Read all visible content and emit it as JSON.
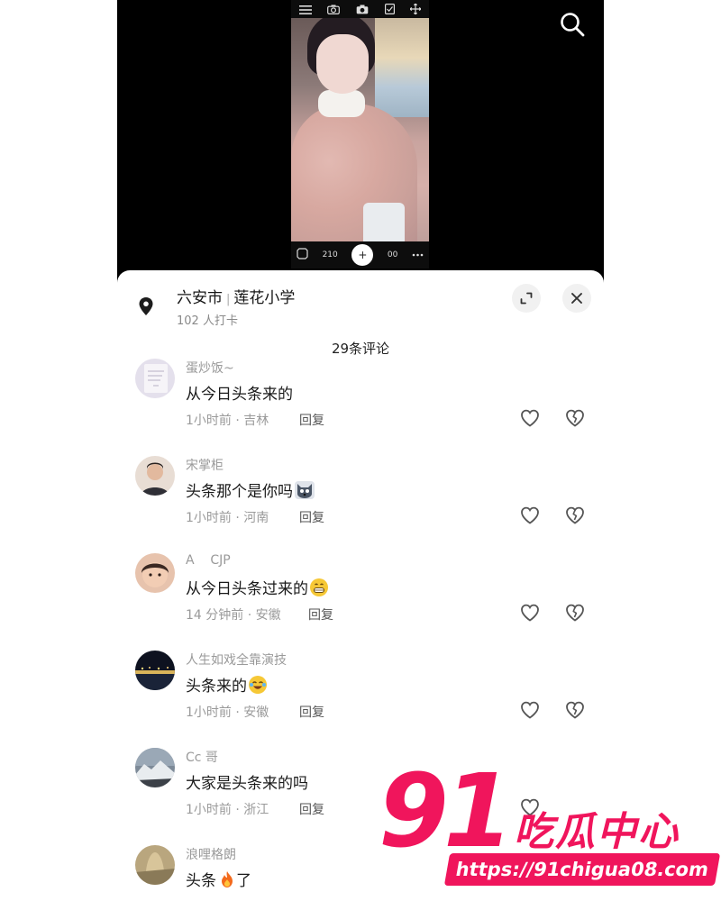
{
  "location": {
    "city": "六安市",
    "place": "莲花小学",
    "checkins": "102 人打卡"
  },
  "comment_count_label": "29条评论",
  "comments": [
    {
      "user": "蛋炒饭~",
      "text": "从今日头条来的",
      "emoji": "",
      "meta": "1小时前 · 吉林",
      "reply": "回复"
    },
    {
      "user": "宋掌柜",
      "text": "头条那个是你吗",
      "emoji": "dog-face",
      "meta": "1小时前 · 河南",
      "reply": "回复"
    },
    {
      "user": "A    CJP",
      "text": "从今日头条过来的",
      "emoji": "grin-face",
      "meta": "14 分钟前 · 安徽",
      "reply": "回复"
    },
    {
      "user": "人生如戏全靠演技",
      "text": "头条来的",
      "emoji": "laugh-cry-face",
      "meta": "1小时前 · 安徽",
      "reply": "回复"
    },
    {
      "user": "Cc 哥",
      "text": "大家是头条来的吗",
      "emoji": "",
      "meta": "1小时前 · 浙江",
      "reply": "回复"
    },
    {
      "user": "浪哩格朗",
      "text": "头条",
      "emoji": "fire",
      "text_after": "了",
      "meta": "",
      "reply": ""
    }
  ],
  "camera": {
    "counter_left": "210",
    "counter_right": "00",
    "shutter_symbol": "+"
  },
  "watermark": {
    "number": "91",
    "name": "吃瓜中心",
    "url": "https://91chigua08.com"
  },
  "colors": {
    "accent": "#f0155c",
    "muted_text": "#9a9a9a"
  }
}
